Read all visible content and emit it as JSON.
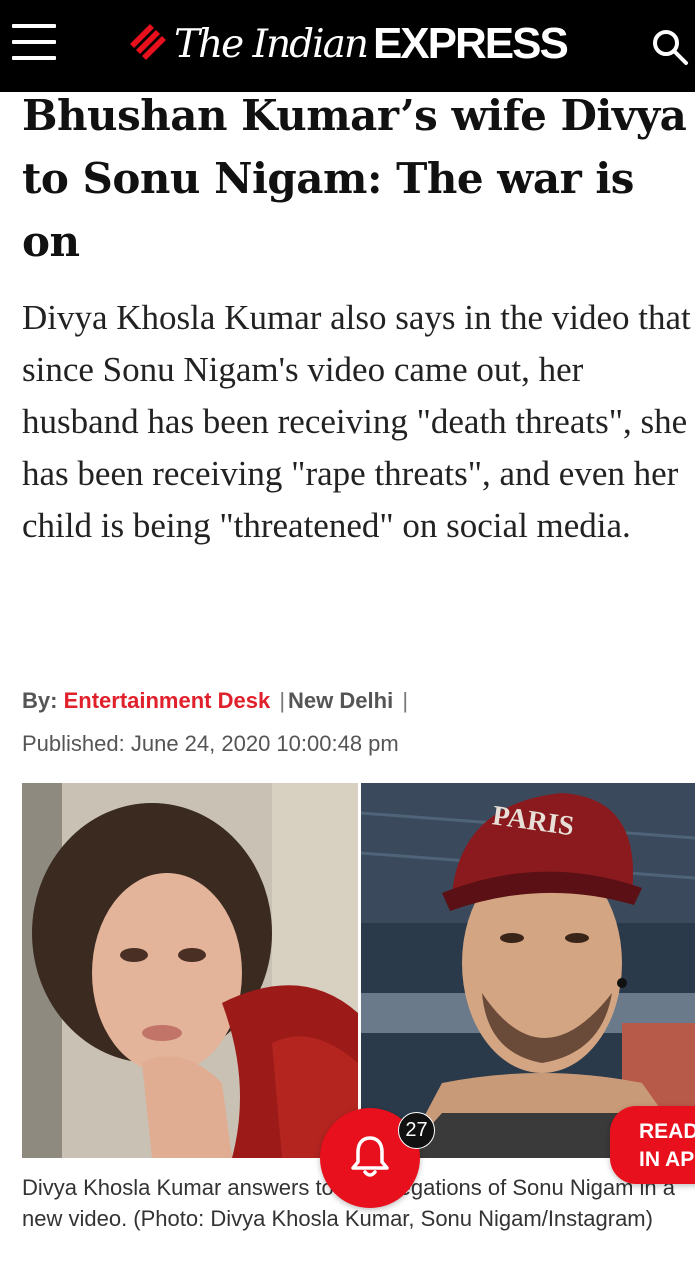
{
  "header": {
    "logo_the": "The Indian",
    "logo_express": "EXPRESS",
    "colors": {
      "background": "#000000",
      "brand_red": "#e8101c"
    },
    "icons": [
      "menu-icon",
      "search-icon"
    ]
  },
  "article": {
    "headline": "Bhushan Kumar’s wife Divya to Sonu Nigam: The war is on",
    "summary": "Divya Khosla Kumar also says in the video that since Sonu Nigam's video came out, her husband has been receiving \"death threats\", she has been receiving \"rape threats\", and even her child is being \"threatened\" on social media.",
    "byline": {
      "by_label": "By:",
      "author": "Entertainment Desk",
      "separator": "|",
      "location": "New Delhi"
    },
    "published": "Published: June 24, 2020 10:00:48 pm",
    "photo": {
      "cap_text": "PARIS"
    },
    "caption": "Divya Khosla Kumar answers to the allegations of Sonu Nigam in a new video. (Photo: Divya Khosla Kumar, Sonu Nigam/Instagram)"
  },
  "notifications": {
    "count": "27",
    "icon": "bell-icon"
  },
  "read_app": {
    "line1": "READ",
    "line2": "IN AP"
  }
}
